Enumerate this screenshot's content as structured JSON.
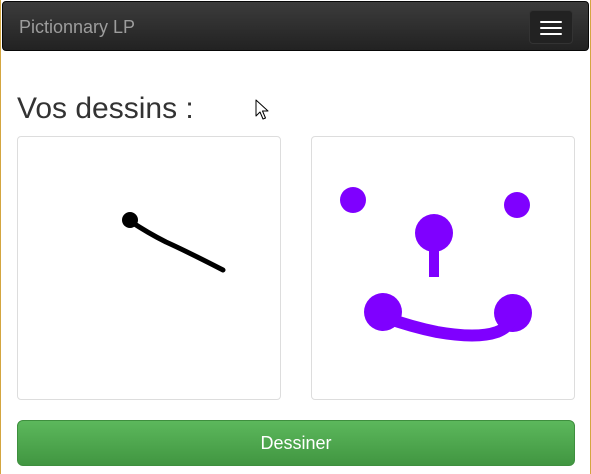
{
  "navbar": {
    "brand": "Pictionnary LP",
    "menu_icon": "hamburger-menu-icon"
  },
  "main": {
    "heading": "Vos dessins :",
    "drawings": [
      {
        "stroke_color": "#000000"
      },
      {
        "stroke_color": "#7f00ff"
      }
    ],
    "draw_button_label": "Dessiner"
  },
  "colors": {
    "navbar_background": "#222222",
    "brand_text": "#9d9d9d",
    "button_green": "#5cb85c",
    "drawing_black": "#000000",
    "drawing_purple": "#7f00ff"
  }
}
